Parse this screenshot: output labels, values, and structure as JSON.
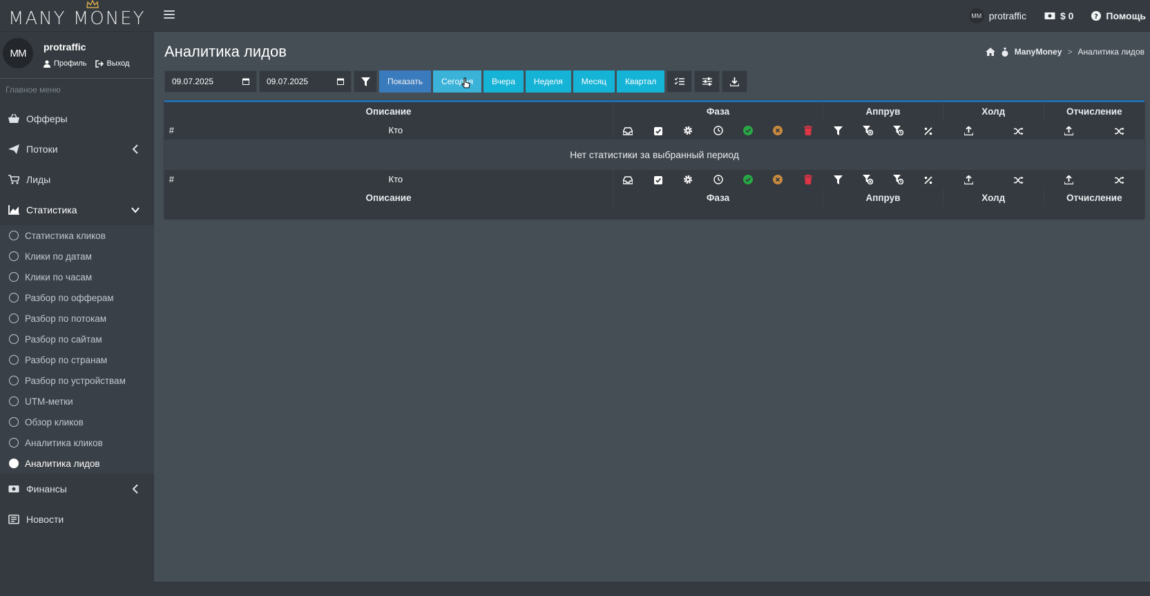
{
  "brand": {
    "logo_text": "MANY MONEY"
  },
  "header": {
    "username": "protraffic",
    "balance": "$ 0",
    "help": "Помощь"
  },
  "sidebar": {
    "user": {
      "name": "protraffic",
      "profile": "Профиль",
      "logout": "Выход"
    },
    "menu_header": "Главное меню",
    "items": [
      {
        "label": "Офферы",
        "icon": "basket-icon"
      },
      {
        "label": "Потоки",
        "icon": "paper-plane-icon"
      },
      {
        "label": "Лиды",
        "icon": "cart-icon"
      },
      {
        "label": "Статистика",
        "icon": "chart-icon"
      },
      {
        "label": "Финансы",
        "icon": "money-icon"
      },
      {
        "label": "Новости",
        "icon": "newspaper-icon"
      }
    ],
    "stats_sub": [
      "Статистика кликов",
      "Клики по датам",
      "Клики по часам",
      "Разбор по офферам",
      "Разбор по потокам",
      "Разбор по сайтам",
      "Разбор по странам",
      "Разбор по устройствам",
      "UTM-метки",
      "Обзор кликов",
      "Аналитика кликов",
      "Аналитика лидов"
    ]
  },
  "page": {
    "title": "Аналитика лидов",
    "breadcrumb": {
      "home": "ManyMoney",
      "sep": ">",
      "current": "Аналитика лидов"
    }
  },
  "filters": {
    "date_from": "09.07.2025",
    "date_to": "09.07.2025",
    "show": "Показать",
    "today": "Сегодня",
    "yesterday": "Вчера",
    "week": "Неделя",
    "month": "Месяц",
    "quarter": "Квартал"
  },
  "table": {
    "group_headers": [
      "Описание",
      "Фаза",
      "Аппрув",
      "Холд",
      "Отчисление"
    ],
    "col_hash": "#",
    "col_who": "Кто",
    "empty": "Нет статистики за выбранный период"
  },
  "colors": {
    "success": "#28a745",
    "warning": "#c98a3e",
    "danger": "#dc3545",
    "primary": "#3a7bbd",
    "info": "#17a2b8"
  }
}
